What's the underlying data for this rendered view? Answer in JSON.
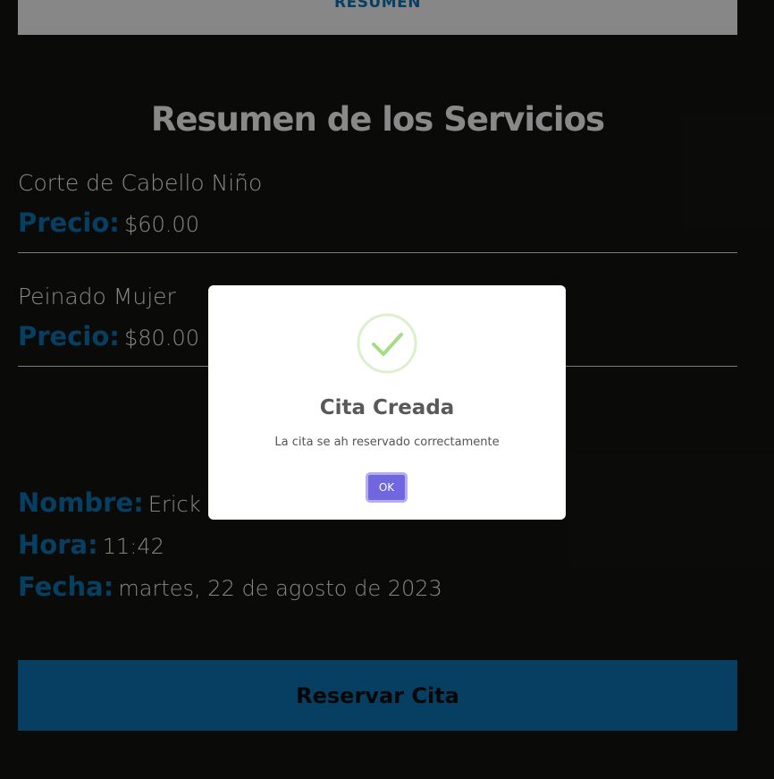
{
  "tab": {
    "label": "RESUMEN"
  },
  "summary": {
    "heading": "Resumen de los Servicios",
    "services": [
      {
        "name": "Corte de Cabello Niño",
        "price_label": "Precio:",
        "price": "$60.00"
      },
      {
        "name": "Peinado Mujer",
        "price_label": "Precio:",
        "price": "$80.00"
      }
    ]
  },
  "appointment": {
    "name_label": "Nombre:",
    "name_value": "Erick P",
    "time_label": "Hora:",
    "time_value": "11:42",
    "date_label": "Fecha:",
    "date_value": "martes, 22 de agosto de 2023"
  },
  "actions": {
    "reserve_label": "Reservar Cita"
  },
  "modal": {
    "title": "Cita Creada",
    "message": "La cita se ah reservado correctamente",
    "ok_label": "OK",
    "icon": "success-check-icon"
  },
  "colors": {
    "background": "#121310",
    "accent": "#0c6aa3",
    "modal_button": "#7066e0",
    "success": "#a5dc86"
  }
}
